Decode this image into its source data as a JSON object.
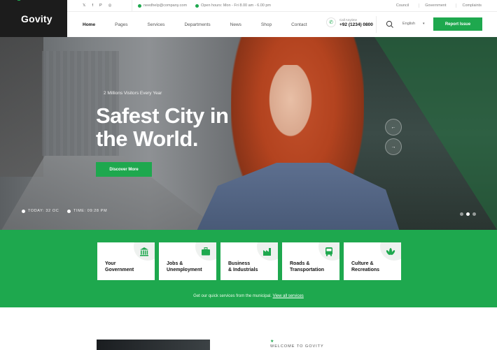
{
  "logo": {
    "text": "Govity"
  },
  "topbar": {
    "social_icons": [
      "twitter-icon",
      "facebook-icon",
      "pinterest-icon",
      "instagram-icon"
    ],
    "social_glyphs": [
      "𝕏",
      "f",
      "P",
      "◎"
    ],
    "email": "needhelp@company.com",
    "hours": "Open hours: Mon - Fri 8.00 am - 6.00 pm",
    "links": [
      "Council",
      "Government",
      "Complaints"
    ]
  },
  "nav": {
    "items": [
      "Home",
      "Pages",
      "Services",
      "Departments",
      "News",
      "Shop",
      "Contact"
    ],
    "active": "Home",
    "call_label": "Call Anytime",
    "call_number": "+92 (1234) 0800",
    "language": "English",
    "report_label": "Report Issue"
  },
  "hero": {
    "subtitle": "2 Millions Visitors Every Year",
    "title_line1": "Safest City in",
    "title_line2": "the World.",
    "button_label": "Discover More",
    "today": "TODAY: 32 OC",
    "time": "TIME: 09:28 PM",
    "prev_glyph": "←",
    "next_glyph": "→",
    "slide_count": 3,
    "active_slide": 2
  },
  "services": {
    "cards": [
      {
        "label": "Your\nGovernment",
        "icon": "building-columns-icon"
      },
      {
        "label": "Jobs &\nUnemployment",
        "icon": "briefcase-icon"
      },
      {
        "label": "Business\n& Industrials",
        "icon": "factory-icon"
      },
      {
        "label": "Roads &\nTransportation",
        "icon": "bus-icon"
      },
      {
        "label": "Culture &\nRecreations",
        "icon": "lotus-icon"
      }
    ],
    "note_text": "Get our quick services from the municipal.",
    "note_link": "View all services"
  },
  "about": {
    "eyebrow": "WELCOME TO GOVITY"
  },
  "colors": {
    "accent": "#1ea84e",
    "dark": "#1c1c1c"
  }
}
